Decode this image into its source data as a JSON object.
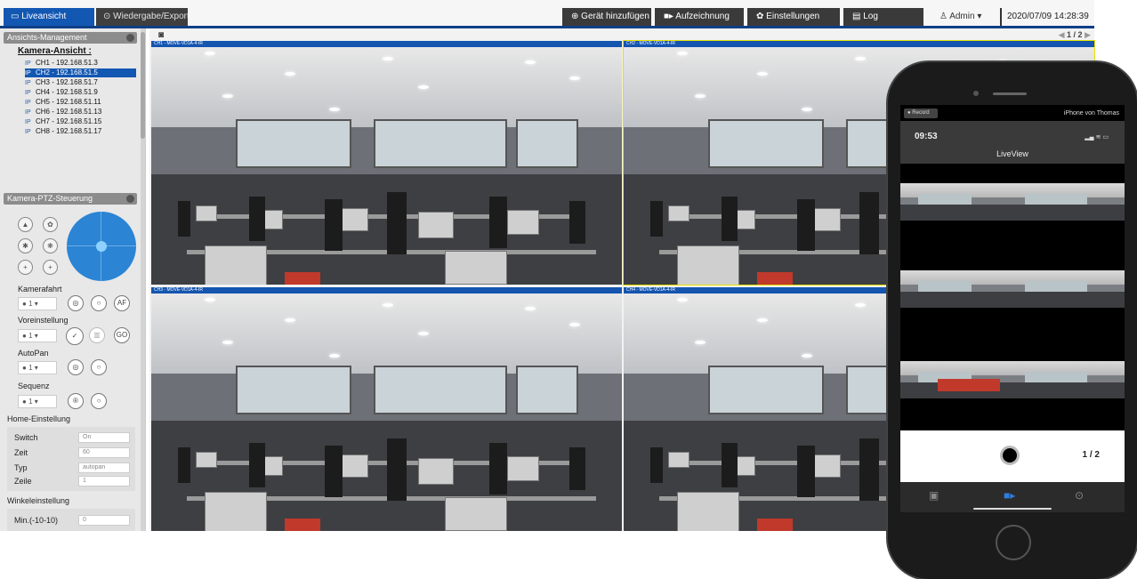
{
  "topbar": {
    "tabs": [
      {
        "label": "Liveansicht",
        "icon": "monitor-icon",
        "active": true
      },
      {
        "label": "Wiedergabe/Export",
        "icon": "play-circle-icon",
        "active": false
      }
    ],
    "buttons": [
      {
        "label": "Gerät hinzufügen",
        "icon": "plus-circle-icon"
      },
      {
        "label": "Aufzeichnung",
        "icon": "camera-icon"
      },
      {
        "label": "Einstellungen",
        "icon": "gear-icon"
      },
      {
        "label": "Log",
        "icon": "document-icon"
      }
    ],
    "user": "Admin",
    "datetime": "2020/07/09 14:28:39",
    "accent": "#1257b2"
  },
  "view_management": {
    "title": "Ansichts-Management",
    "root_label": "Kamera-Ansicht :",
    "cameras": [
      {
        "label": "CH1 - 192.168.51.3",
        "selected": false
      },
      {
        "label": "CH2 - 192.168.51.5",
        "selected": true
      },
      {
        "label": "CH3 - 192.168.51.7",
        "selected": false
      },
      {
        "label": "CH4 - 192.168.51.9",
        "selected": false
      },
      {
        "label": "CH5 - 192.168.51.11",
        "selected": false
      },
      {
        "label": "CH6 - 192.168.51.13",
        "selected": false
      },
      {
        "label": "CH7 - 192.168.51.15",
        "selected": false
      },
      {
        "label": "CH8 - 192.168.51.17",
        "selected": false
      }
    ],
    "camera_icon_text": "IP"
  },
  "ptz": {
    "title": "Kamera-PTZ-Steuerung",
    "kamerafahrt": "Kamerafahrt",
    "voreinstellung": "Voreinstellung",
    "autopan": "AutoPan",
    "sequenz": "Sequenz",
    "select_value": "1",
    "af_label": "AF",
    "go_label": "GO"
  },
  "home_settings": {
    "title": "Home-Einstellung",
    "rows": [
      {
        "label": "Switch",
        "value": "On"
      },
      {
        "label": "Zeit",
        "value": "60"
      },
      {
        "label": "Typ",
        "value": "autopan"
      },
      {
        "label": "Zeile",
        "value": "1"
      }
    ]
  },
  "angle_settings": {
    "title": "Winkeleinstellung",
    "min_label": "Min.(-10-10)",
    "min_value": "0"
  },
  "video": {
    "pager": "1 / 2",
    "tiles": [
      {
        "title": "CH1 - MOVE-VD1A-4-IR"
      },
      {
        "title": "CH2 - MOVE-VD1A-4-IR"
      },
      {
        "title": "CH3 - MOVE-VD1A-4-IR"
      },
      {
        "title": "CH4 - MOVE-VD1A-4-IR"
      }
    ]
  },
  "phone": {
    "record_btn": "Record",
    "device_name": "iPhone von Thomas",
    "time": "09:53",
    "title": "LiveView",
    "page": "1 / 2"
  }
}
